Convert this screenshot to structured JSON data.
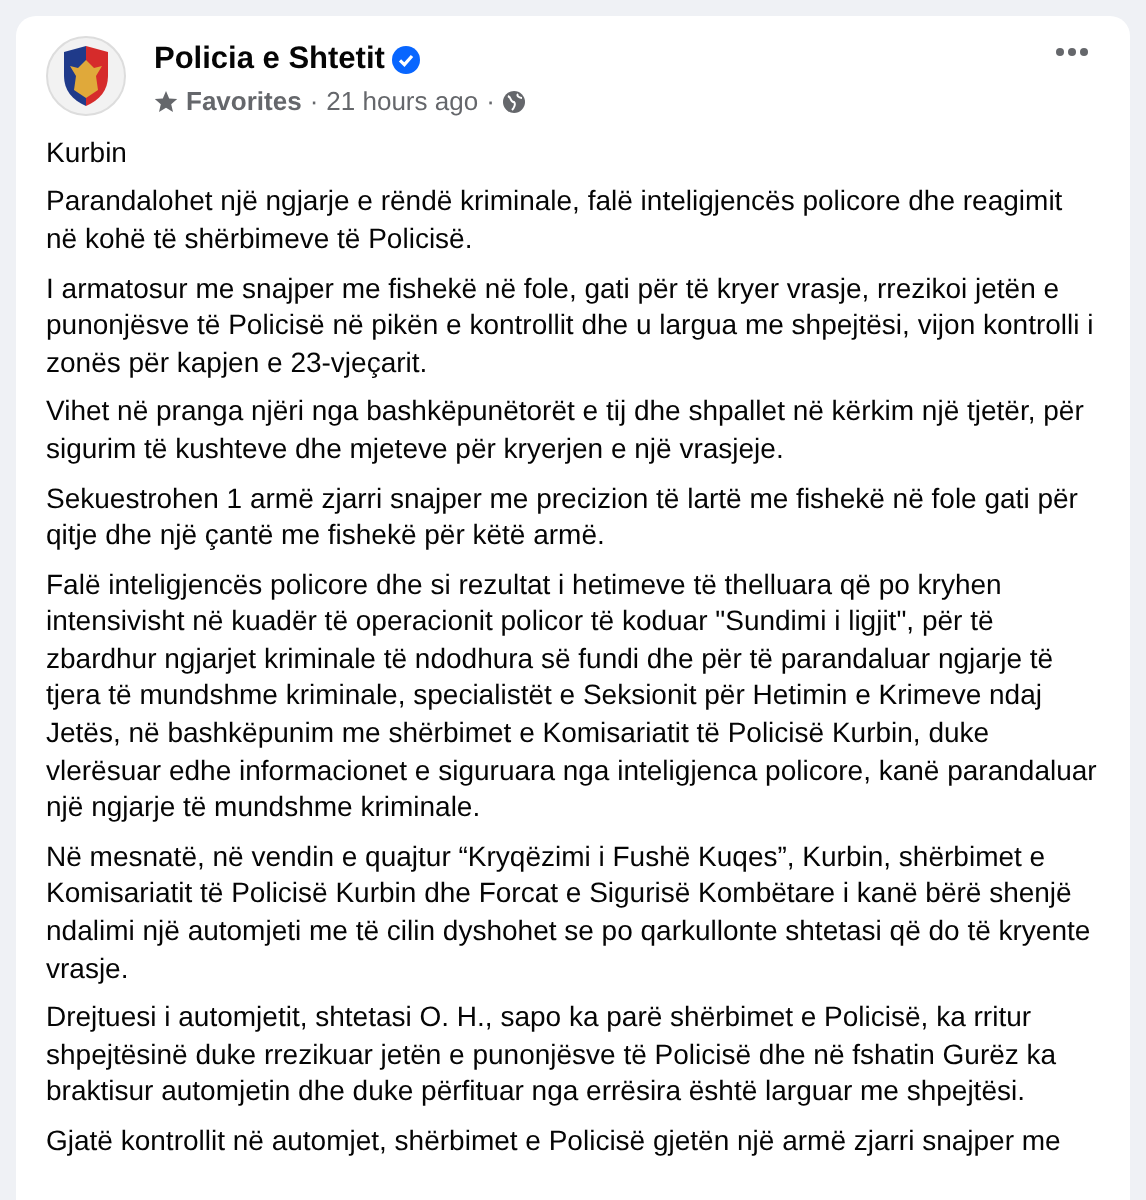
{
  "post": {
    "author": "Policia e Shtetit",
    "verified": true,
    "audience_label": "Favorites",
    "separator_1": "·",
    "time": "21 hours ago",
    "separator_2": "·",
    "paragraphs": [
      "Kurbin",
      "Parandalohet një ngjarje e rëndë kriminale, falë inteligjencës policore dhe reagimit në kohë të shërbimeve të Policisë.",
      "I armatosur me snajper me fishekë në fole, gati për të kryer vrasje, rrezikoi jetën e punonjësve të Policisë në pikën e kontrollit dhe u largua me shpejtësi, vijon kontrolli i zonës për kapjen e 23-vjeçarit.",
      "Vihet në pranga njëri nga bashkëpunëtorët e tij dhe shpallet në kërkim një tjetër, për sigurim të kushteve dhe mjeteve për kryerjen e një vrasjeje.",
      "Sekuestrohen 1 armë zjarri snajper me precizion të lartë me fishekë në fole gati për qitje dhe një çantë me fishekë për këtë armë.",
      "Falë inteligjencës policore dhe si rezultat i hetimeve të thelluara që po kryhen intensivisht në kuadër të operacionit policor të koduar \"Sundimi i ligjit\", për të zbardhur ngjarjet kriminale të ndodhura së fundi dhe për të parandaluar ngjarje të tjera të mundshme kriminale, specialistët e Seksionit për Hetimin e Krimeve ndaj Jetës, në bashkëpunim me shërbimet e Komisariatit të Policisë Kurbin, duke vlerësuar edhe informacionet e siguruara nga inteligjenca policore, kanë parandaluar një ngjarje të mundshme kriminale.",
      "Në mesnatë, në vendin e quajtur “Kryqëzimi i Fushë Kuqes”, Kurbin, shërbimet e Komisariatit të Policisë Kurbin dhe Forcat e Sigurisë Kombëtare i kanë bërë shenjë ndalimi një automjeti me të cilin dyshohet se po qarkullonte shtetasi që do të kryente vrasje.",
      "Drejtuesi i automjetit, shtetasi O. H., sapo ka parë shërbimet e Policisë, ka rritur shpejtësinë duke rrezikuar jetën e punonjësve të Policisë dhe në fshatin Gurëz ka braktisur automjetin dhe duke përfituar nga errësira është larguar me shpejtësi.",
      "Gjatë kontrollit në automjet, shërbimet e Policisë gjetën një armë zjarri snajper me"
    ]
  }
}
